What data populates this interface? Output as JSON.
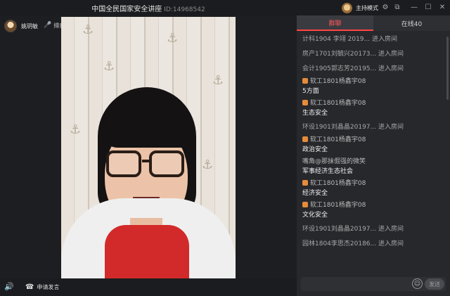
{
  "window": {
    "title": "中国全民国家安全讲座",
    "room_id": "ID:14968542",
    "host_mode_label": "主持模式",
    "controls": {
      "settings": "⚙",
      "popout": "⧉",
      "minimize": "—",
      "maximize": "☐",
      "close": "✕"
    }
  },
  "stage": {
    "presenter_name": "姚玥敏",
    "rank_label": "排麦",
    "rank_icon": "🎤",
    "volume_icon": "🔊",
    "speak_icon": "☎",
    "speak_label": "申请发言"
  },
  "panel": {
    "tabs": [
      {
        "label": "群聊",
        "active": true
      },
      {
        "label": "在线40",
        "active": false
      }
    ],
    "messages": [
      {
        "who": "计科1904 李翊 2019...",
        "action": " 进入房间"
      },
      {
        "who": "房产1701刘毓兴20173...",
        "action": " 进入房间"
      },
      {
        "who": "会计1905郭志芳20195...",
        "action": " 进入房间"
      },
      {
        "who": "软工1801杨鑫宇08",
        "text": "5方面",
        "badge": true
      },
      {
        "who": "软工1801杨鑫宇08",
        "text": "生态安全",
        "badge": true
      },
      {
        "who": "环设1901刘晶晶20197...",
        "action": " 进入房间"
      },
      {
        "who": "软工1801杨鑫宇08",
        "text": "政治安全",
        "badge": true
      },
      {
        "who": "嘴角@那抹倔强的微笑",
        "text": "军事经济生态社会"
      },
      {
        "who": "软工1801杨鑫宇08",
        "text": "经济安全",
        "badge": true
      },
      {
        "who": "软工1801杨鑫宇08",
        "text": "文化安全",
        "badge": true
      },
      {
        "who": "环设1901刘晶晶20197...",
        "action": " 进入房间"
      },
      {
        "who": "园林1804李思杰20186...",
        "action": " 进入房间"
      }
    ],
    "input_placeholder": "",
    "emoji_icon": "☺",
    "send_label": "发送"
  }
}
